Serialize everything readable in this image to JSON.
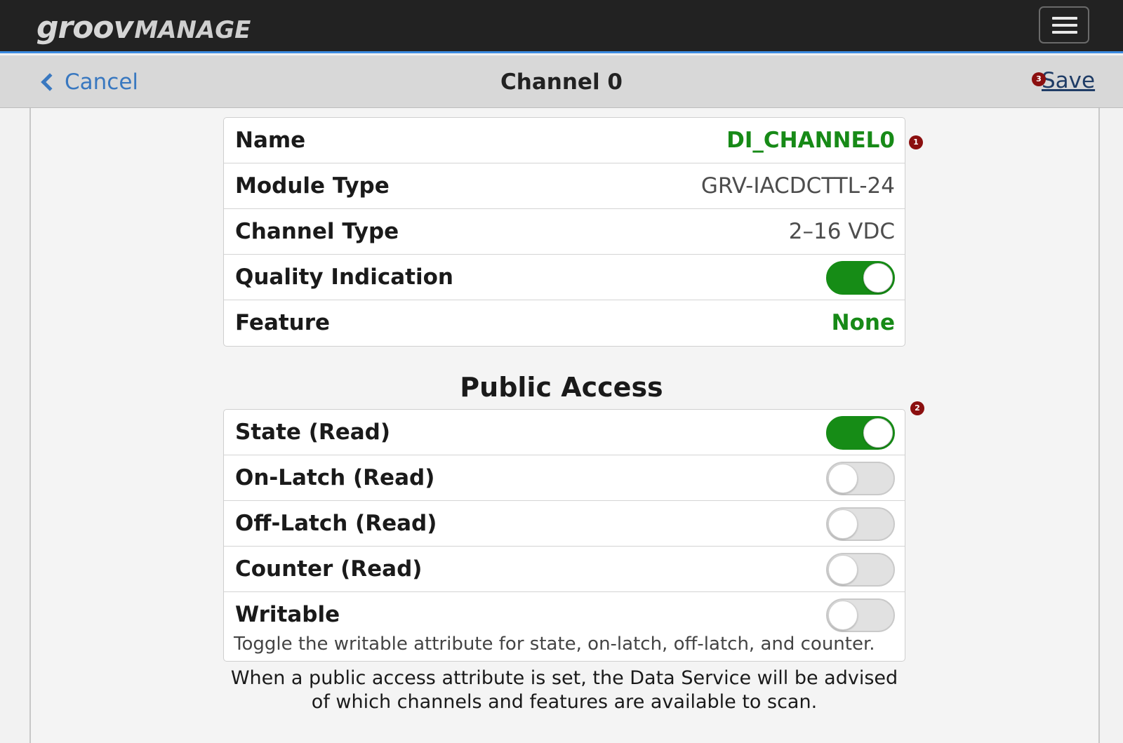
{
  "app": {
    "logo_part1": "groov",
    "logo_part2": "MANAGE"
  },
  "nav": {
    "cancel_label": "Cancel",
    "title": "Channel 0",
    "save_label": "Save"
  },
  "badges": {
    "name_badge": "1",
    "public_access_badge": "2",
    "save_badge": "3"
  },
  "details": {
    "name_label": "Name",
    "name_value": "DI_CHANNEL0",
    "module_type_label": "Module Type",
    "module_type_value": "GRV-IACDCTTL-24",
    "channel_type_label": "Channel Type",
    "channel_type_value": "2–16 VDC",
    "quality_label": "Quality Indication",
    "quality_on": true,
    "feature_label": "Feature",
    "feature_value": "None"
  },
  "public_access": {
    "title": "Public Access",
    "state_label": "State (Read)",
    "state_on": true,
    "on_latch_label": "On-Latch (Read)",
    "on_latch_on": false,
    "off_latch_label": "Off-Latch (Read)",
    "off_latch_on": false,
    "counter_label": "Counter (Read)",
    "counter_on": false,
    "writable_label": "Writable",
    "writable_on": false,
    "writable_desc": "Toggle the writable attribute for state, on-latch, off-latch, and counter.",
    "footnote": "When a public access attribute is set, the Data Service will be advised of which channels and features are available to scan."
  },
  "colors": {
    "accent_blue": "#3c8be0",
    "link_blue": "#3978c0",
    "toggle_on": "#168c16",
    "value_green": "#178a17",
    "badge_red": "#8b0f0f"
  }
}
